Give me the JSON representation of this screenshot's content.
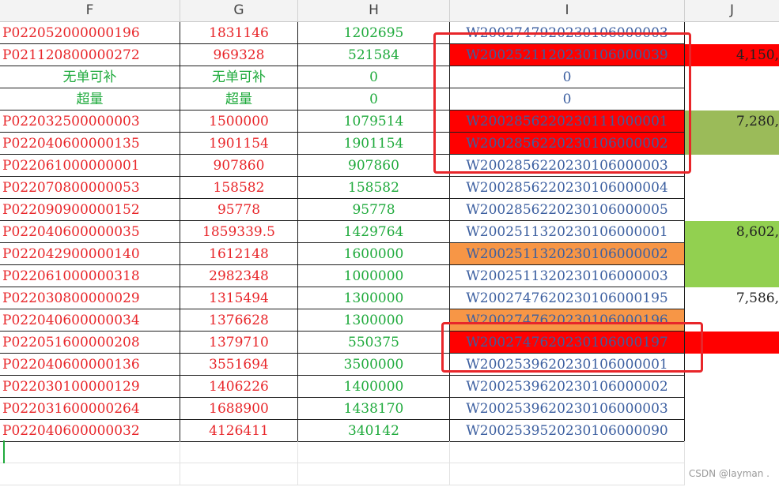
{
  "columns": [
    "F",
    "G",
    "H",
    "I",
    "J"
  ],
  "colors": {
    "red": "#ff0000",
    "orange": "#f79646",
    "olive": "#9bbb59",
    "lightgreen": "#92d050"
  },
  "rows": [
    {
      "f": "P022052000000196",
      "g": "1831146",
      "h": "1202695",
      "i": "W2002747920230106000003",
      "j": "",
      "ibg": "",
      "jbg": ""
    },
    {
      "f": "P021120800000272",
      "g": "969328",
      "h": "521584",
      "i": "W2002521120230106000039",
      "j": "4,150,",
      "ibg": "#ff0000",
      "jbg": "#ff0000"
    },
    {
      "f": "无单可补",
      "g": "无单可补",
      "h": "0",
      "i": "0",
      "j": "",
      "ibg": "",
      "jbg": "",
      "fgreen": true
    },
    {
      "f": "超量",
      "g": "超量",
      "h": "0",
      "i": "0",
      "j": "",
      "ibg": "",
      "jbg": "",
      "fgreen": true
    },
    {
      "f": "P022032500000003",
      "g": "1500000",
      "h": "1079514",
      "i": "W2002856220230111000001",
      "j": "7,280,",
      "ibg": "#ff0000",
      "jbg": "#9bbb59"
    },
    {
      "f": "P022040600000135",
      "g": "1901154",
      "h": "1901154",
      "i": "W2002856220230106000002",
      "j": "",
      "ibg": "#ff0000",
      "jbg": "#9bbb59"
    },
    {
      "f": "P022061000000001",
      "g": "907860",
      "h": "907860",
      "i": "W2002856220230106000003",
      "j": "",
      "ibg": "",
      "jbg": ""
    },
    {
      "f": "P022070800000053",
      "g": "158582",
      "h": "158582",
      "i": "W2002856220230106000004",
      "j": "",
      "ibg": "",
      "jbg": ""
    },
    {
      "f": "P022090900000152",
      "g": "95778",
      "h": "95778",
      "i": "W2002856220230106000005",
      "j": "",
      "ibg": "",
      "jbg": ""
    },
    {
      "f": "P022040600000035",
      "g": "1859339.5",
      "h": "1429764",
      "i": "W2002511320230106000001",
      "j": "8,602,",
      "ibg": "",
      "jbg": "#92d050"
    },
    {
      "f": "P022042900000140",
      "g": "1612148",
      "h": "1600000",
      "i": "W2002511320230106000002",
      "j": "",
      "ibg": "#f79646",
      "jbg": "#92d050"
    },
    {
      "f": "P022061000000318",
      "g": "2982348",
      "h": "1000000",
      "i": "W2002511320230106000003",
      "j": "",
      "ibg": "",
      "jbg": "#92d050"
    },
    {
      "f": "P022030800000029",
      "g": "1315494",
      "h": "1300000",
      "i": "W2002747620230106000195",
      "j": "7,586,",
      "ibg": "",
      "jbg": ""
    },
    {
      "f": "P022040600000034",
      "g": "1376628",
      "h": "1300000",
      "i": "W2002747620230106000196",
      "j": "",
      "ibg": "#f79646",
      "jbg": ""
    },
    {
      "f": "P022051600000208",
      "g": "1379710",
      "h": "550375",
      "i": "W2002747620230106000197",
      "j": "",
      "ibg": "#ff0000",
      "jbg": "#ff0000"
    },
    {
      "f": "P022040600000136",
      "g": "3551694",
      "h": "3500000",
      "i": "W2002539620230106000001",
      "j": "",
      "ibg": "",
      "jbg": ""
    },
    {
      "f": "P022030100000129",
      "g": "1406226",
      "h": "1400000",
      "i": "W2002539620230106000002",
      "j": "",
      "ibg": "",
      "jbg": ""
    },
    {
      "f": "P022031600000264",
      "g": "1688900",
      "h": "1438170",
      "i": "W2002539620230106000003",
      "j": "",
      "ibg": "",
      "jbg": ""
    },
    {
      "f": "P022040600000032",
      "g": "4126411",
      "h": "340142",
      "i": "W2002539520230106000090",
      "j": "",
      "ibg": "",
      "jbg": ""
    }
  ],
  "watermark": "CSDN @layman ."
}
